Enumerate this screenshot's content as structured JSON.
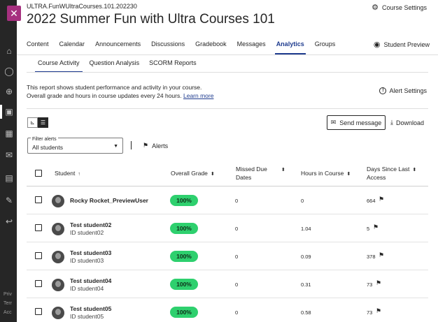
{
  "left_nav": {
    "icons": [
      "institution-icon",
      "profile-icon",
      "globe-icon",
      "courses-icon",
      "calendar-icon",
      "messages-icon",
      "grades-icon",
      "tools-icon",
      "sign-out-icon"
    ],
    "footer": [
      "Priv",
      "Terr",
      "Acc"
    ]
  },
  "header": {
    "course_code": "ULTRA.FunWUltraCourses.101.202230",
    "course_title": "2022 Summer Fun with Ultra Courses 101",
    "settings_label": "Course Settings",
    "student_preview_label": "Student Preview"
  },
  "main_tabs": [
    "Content",
    "Calendar",
    "Announcements",
    "Discussions",
    "Gradebook",
    "Messages",
    "Analytics",
    "Groups"
  ],
  "active_main_tab": "Analytics",
  "sub_tabs": [
    "Course Activity",
    "Question Analysis",
    "SCORM Reports"
  ],
  "active_sub_tab": "Course Activity",
  "info": {
    "line1": "This report shows student performance and activity in your course.",
    "line2": "Overall grade and hours in course updates every 24 hours.",
    "learn_more": "Learn more",
    "alert_settings": "Alert Settings"
  },
  "actions": {
    "send_message": "Send message",
    "download": "Download"
  },
  "filter": {
    "label": "Filter alerts",
    "value": "All students",
    "alerts_label": "Alerts"
  },
  "table": {
    "headers": {
      "student": "Student",
      "grade": "Overall Grade",
      "missed_line1": "Missed Due",
      "missed_line2": "Dates",
      "hours": "Hours in Course",
      "days_line1": "Days Since Last",
      "days_line2": "Access"
    },
    "rows": [
      {
        "name": "Rocky Rocket_PreviewUser",
        "id": "",
        "grade": "100%",
        "missed": "0",
        "hours": "0",
        "days": "664"
      },
      {
        "name": "Test student02",
        "id": "ID student02",
        "grade": "100%",
        "missed": "0",
        "hours": "1.04",
        "days": "5"
      },
      {
        "name": "Test student03",
        "id": "ID student03",
        "grade": "100%",
        "missed": "0",
        "hours": "0.09",
        "days": "378"
      },
      {
        "name": "Test student04",
        "id": "ID student04",
        "grade": "100%",
        "missed": "0",
        "hours": "0.31",
        "days": "73"
      },
      {
        "name": "Test student05",
        "id": "ID student05",
        "grade": "100%",
        "missed": "0",
        "hours": "0.58",
        "days": "73"
      }
    ]
  },
  "colors": {
    "accent": "#1f3c8f",
    "close": "#a6307f",
    "grade_pill": "#2ed06e"
  }
}
